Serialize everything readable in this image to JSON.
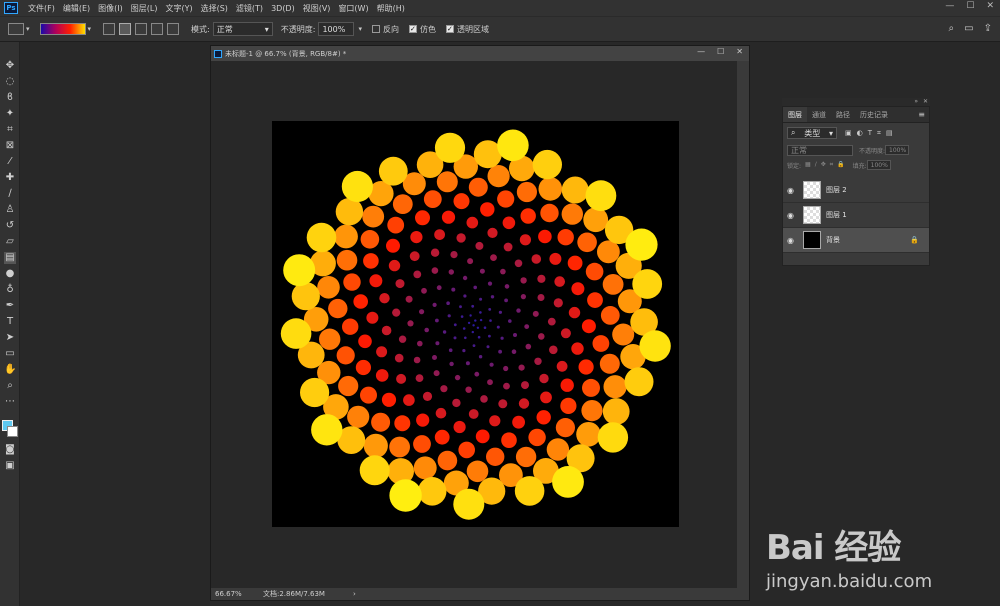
{
  "app": {
    "logo": "Ps",
    "menu": [
      "文件(F)",
      "编辑(E)",
      "图像(I)",
      "图层(L)",
      "文字(Y)",
      "选择(S)",
      "滤镜(T)",
      "3D(D)",
      "视图(V)",
      "窗口(W)",
      "帮助(H)"
    ],
    "window_controls": [
      "—",
      "☐",
      "✕"
    ]
  },
  "options_bar": {
    "mode_label": "模式:",
    "mode_value": "正常",
    "opacity_label": "不透明度:",
    "opacity_value": "100%",
    "reverse_label": "反向",
    "reverse_checked": false,
    "dither_label": "仿色",
    "dither_checked": true,
    "transparency_label": "透明区域",
    "transparency_checked": true,
    "gradient_colors": [
      "#1a0aa8",
      "#b0005a",
      "#ff2000",
      "#ffe000"
    ]
  },
  "document": {
    "title": "未标题-1 @ 66.7% (背景, RGB/8#) *",
    "zoom": "66.67%",
    "doc_size": "文档:2.86M/7.63M",
    "controls": [
      "—",
      "☐",
      "✕"
    ],
    "canvas_bg": "#000000"
  },
  "layers_panel": {
    "tabs": [
      "图层",
      "通道",
      "路径",
      "历史记录"
    ],
    "active_tab": 0,
    "filter_label": "类型",
    "blend_mode": "正常",
    "opacity_label": "不透明度:",
    "opacity_value": "100%",
    "lock_label": "锁定:",
    "fill_label": "填充:",
    "fill_value": "100%",
    "layers": [
      {
        "name": "图层 2",
        "thumb": "checker",
        "selected": false,
        "locked": false
      },
      {
        "name": "图层 1",
        "thumb": "checker",
        "selected": false,
        "locked": false
      },
      {
        "name": "背景",
        "thumb": "black",
        "selected": true,
        "locked": true
      }
    ]
  },
  "watermark": {
    "logo": "Bai 经验",
    "url": "jingyan.baidu.com"
  },
  "artwork": {
    "inner_color": "#2a1aa0",
    "mid_color": "#ff1a00",
    "outer_color": "#ffee10"
  }
}
